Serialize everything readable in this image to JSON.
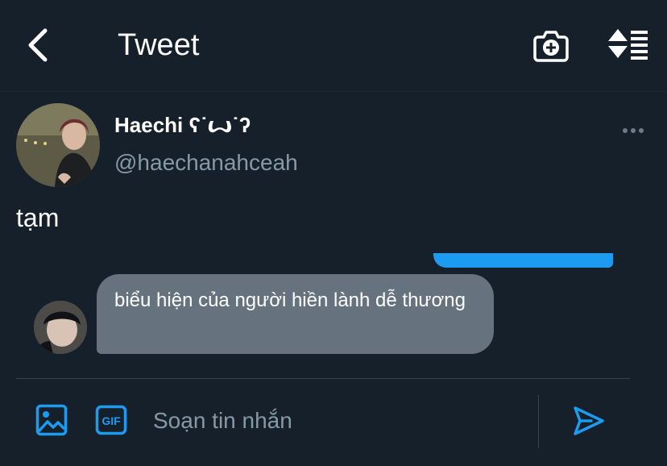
{
  "header": {
    "back_icon": "chevron-left-icon",
    "title": "Tweet",
    "camera_icon": "add-camera-icon",
    "sort_icon": "sort-icon"
  },
  "tweet": {
    "author_name": "Haechi ʕ˙ꙍ˙ʔ",
    "author_handle": "@haechanahceah",
    "more_icon": "more-horizontal-icon",
    "text": "tạm"
  },
  "conversation": {
    "received_message": "biểu hiện của người hiền lành dễ thương"
  },
  "composer": {
    "image_icon": "image-icon",
    "gif_label": "GIF",
    "placeholder": "Soạn tin nhắn",
    "send_icon": "send-icon"
  },
  "colors": {
    "background": "#15202b",
    "accent": "#1d9bf0",
    "bubble_received": "#66737f",
    "muted_text": "#8899a6"
  }
}
